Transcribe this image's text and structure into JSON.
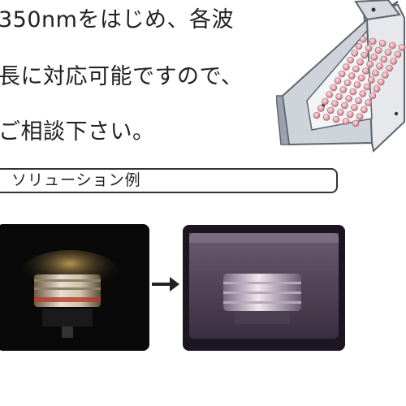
{
  "intro": {
    "lines": [
      "350nmをはじめ、各波",
      "長に対応可能ですので、",
      "ご相談下さい。"
    ]
  },
  "solution": {
    "label": "ソリューション例"
  },
  "icons": {
    "arrow": "right-arrow-icon"
  },
  "colors": {
    "led": "#e8a6ae",
    "frame": "#5c6570"
  }
}
